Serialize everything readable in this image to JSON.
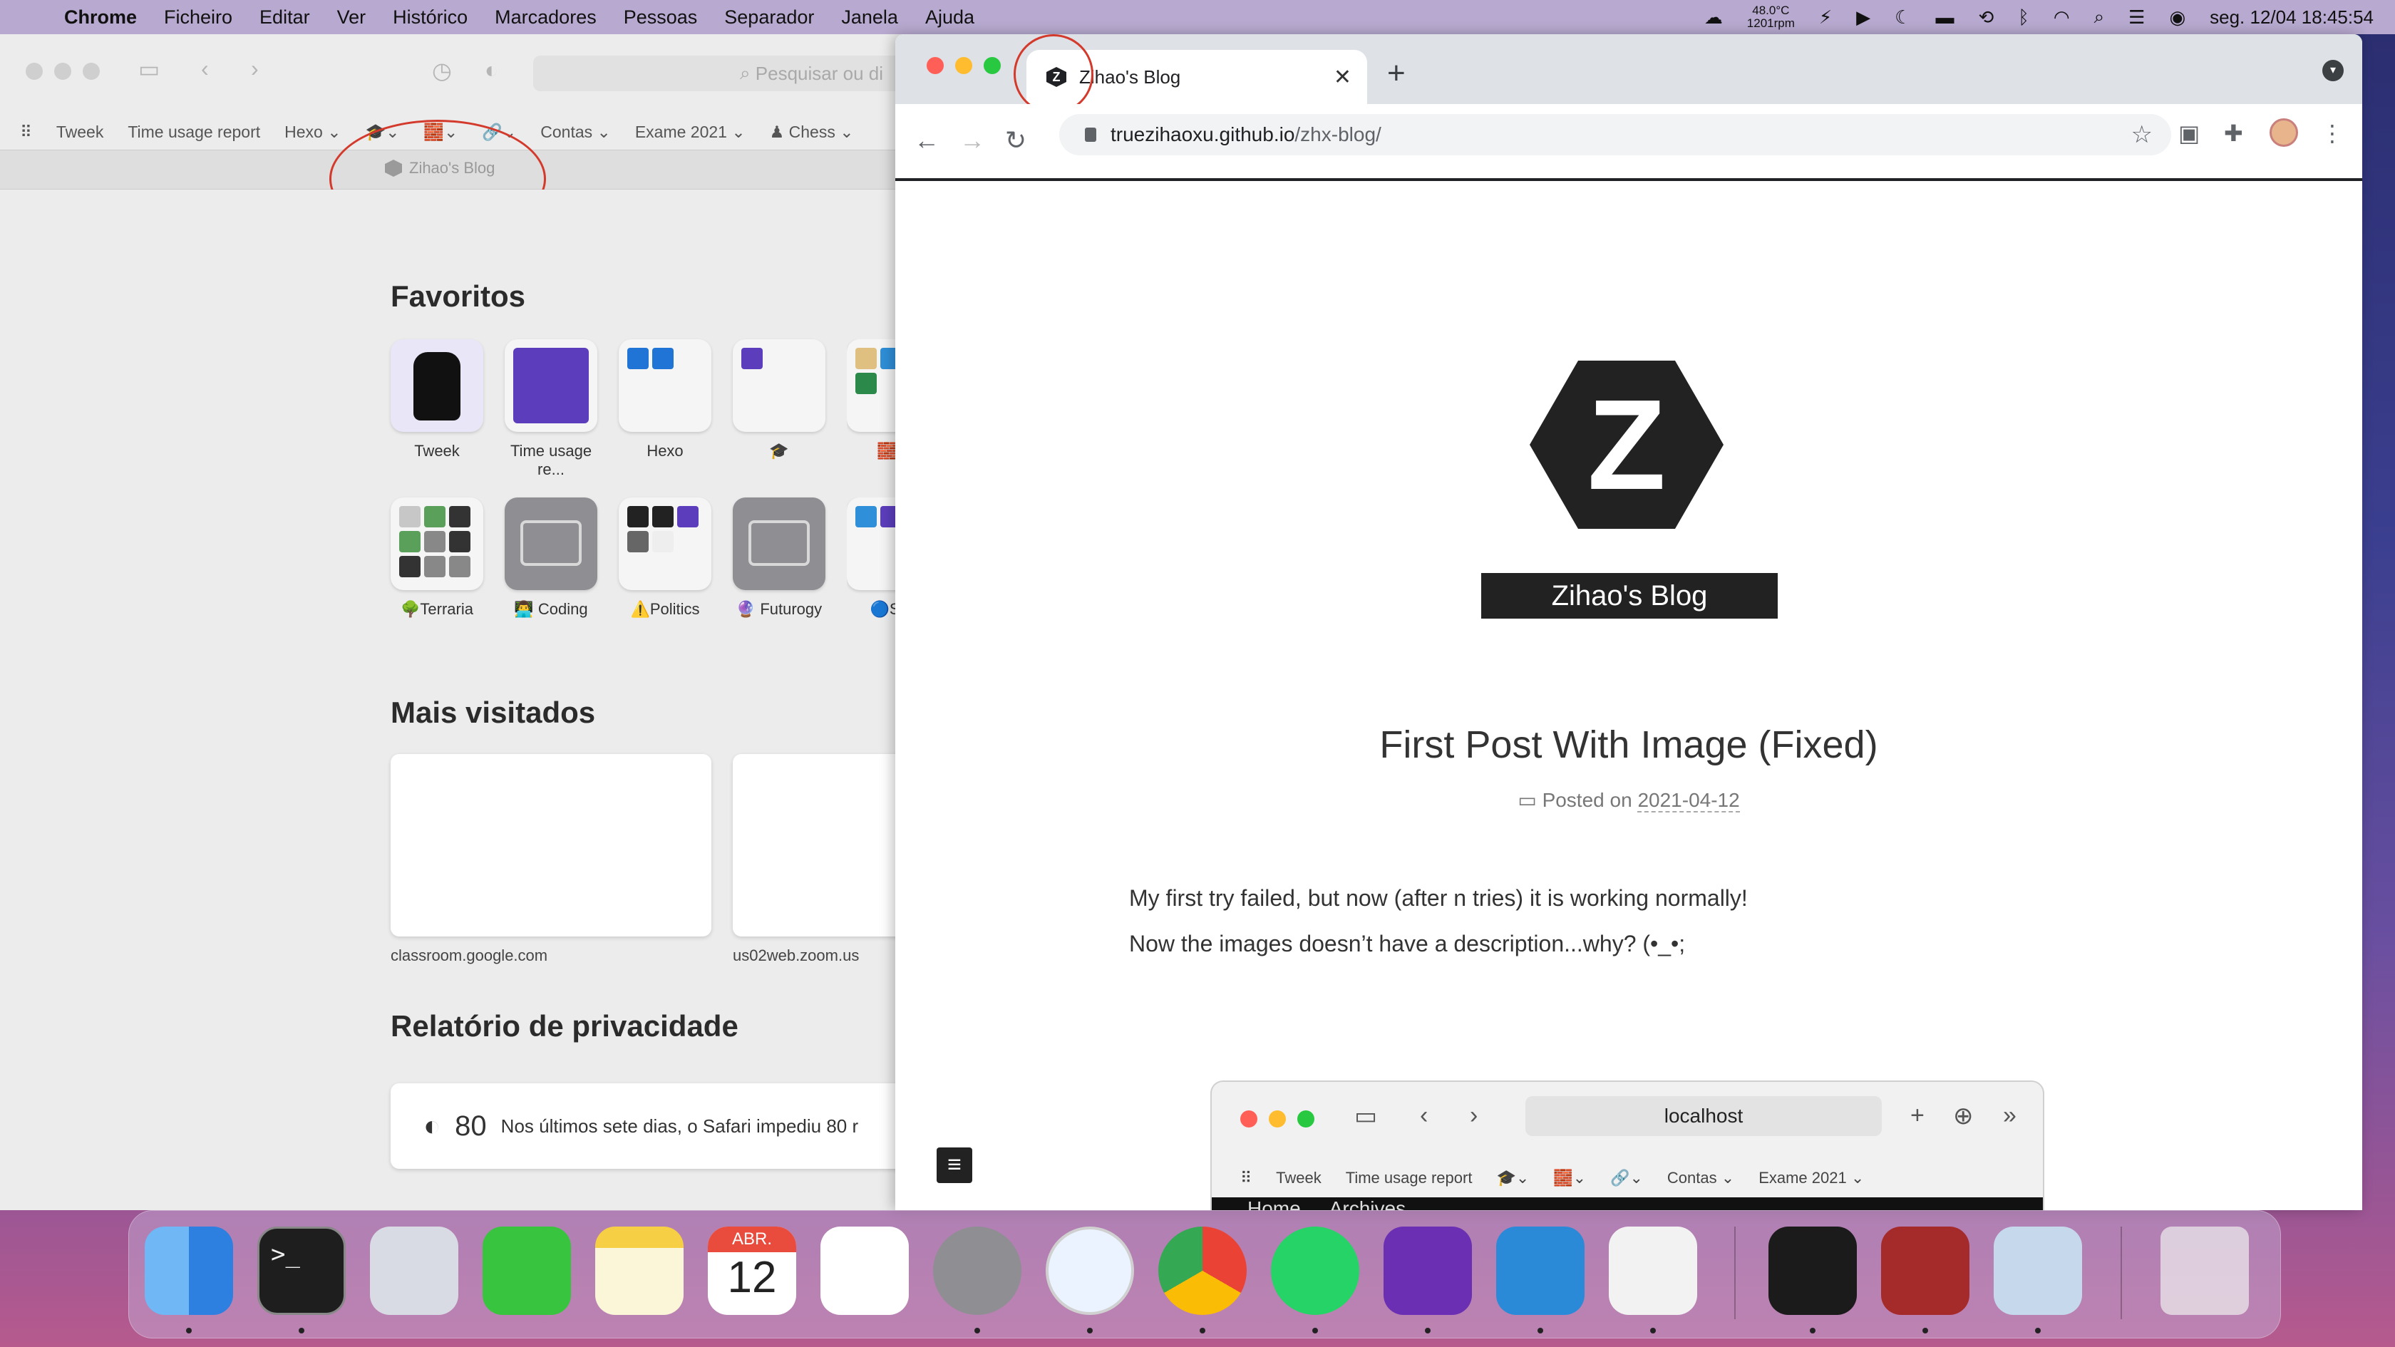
{
  "menubar": {
    "app": "Chrome",
    "items": [
      "Ficheiro",
      "Editar",
      "Ver",
      "Histórico",
      "Marcadores",
      "Pessoas",
      "Separador",
      "Janela",
      "Ajuda"
    ],
    "temp": "48.0°C",
    "rpm": "1201rpm",
    "datetime": "seg. 12/04  18:45:54"
  },
  "safari": {
    "search_placeholder": "Pesquisar ou di",
    "bookmarks": [
      "Tweek",
      "Time usage report",
      "Hexo ⌄",
      "🎓⌄",
      "🧱⌄",
      "🔗⌄",
      "Contas ⌄",
      "Exame 2021 ⌄",
      "♟ Chess ⌄"
    ],
    "tab_title": "Zihao's Blog",
    "favorites_title": "Favoritos",
    "favorites": [
      {
        "label": "Tweek"
      },
      {
        "label": "Time usage re..."
      },
      {
        "label": "Hexo"
      },
      {
        "label": "🎓"
      },
      {
        "label": "🧱"
      },
      {
        "label": "🌳Terraria"
      },
      {
        "label": "👨‍💻 Coding"
      },
      {
        "label": "⚠️Politics"
      },
      {
        "label": "🔮 Futurogy"
      },
      {
        "label": "🔵Si"
      }
    ],
    "most_visited_title": "Mais visitados",
    "most_visited": [
      {
        "label": "classroom.google.com"
      },
      {
        "label": "us02web.zoom.us"
      }
    ],
    "privacy_title": "Relatório de privacidade",
    "privacy_count": "80",
    "privacy_text": "Nos últimos sete dias, o Safari impediu 80 r"
  },
  "chrome": {
    "tab_title": "Zihao's Blog",
    "url_host": "truezihaoxu.github.io",
    "url_path": "/zhx-blog/",
    "page": {
      "logo_letter": "Z",
      "blog_title": "Zihao's Blog",
      "post_title": "First Post With Image (Fixed)",
      "posted_on": "Posted on",
      "date": "2021-04-12",
      "para1": "My first try failed, but now (after n tries) it is working normally!",
      "para2": "Now the images doesn’t have a description...why? (•_•;"
    },
    "embed": {
      "url": "localhost",
      "bookmarks": [
        "Tweek",
        "Time usage report",
        "🎓⌄",
        "🧱⌄",
        "🔗⌄",
        "Contas ⌄",
        "Exame 2021 ⌄"
      ],
      "nav": [
        "Home",
        "Archives"
      ]
    }
  },
  "dock": {
    "apps": [
      "Finder",
      "Terminal",
      "Launchpad",
      "Messages",
      "Notes",
      "Calendar",
      "Numbers",
      "System Preferences",
      "Safari",
      "Chrome",
      "WhatsApp",
      "Visual Studio",
      "VS Code",
      "TextEdit",
      "Activity Monitor",
      "Dictionary",
      "Preview",
      "Trash"
    ],
    "calendar_month": "ABR.",
    "calendar_day": "12"
  }
}
